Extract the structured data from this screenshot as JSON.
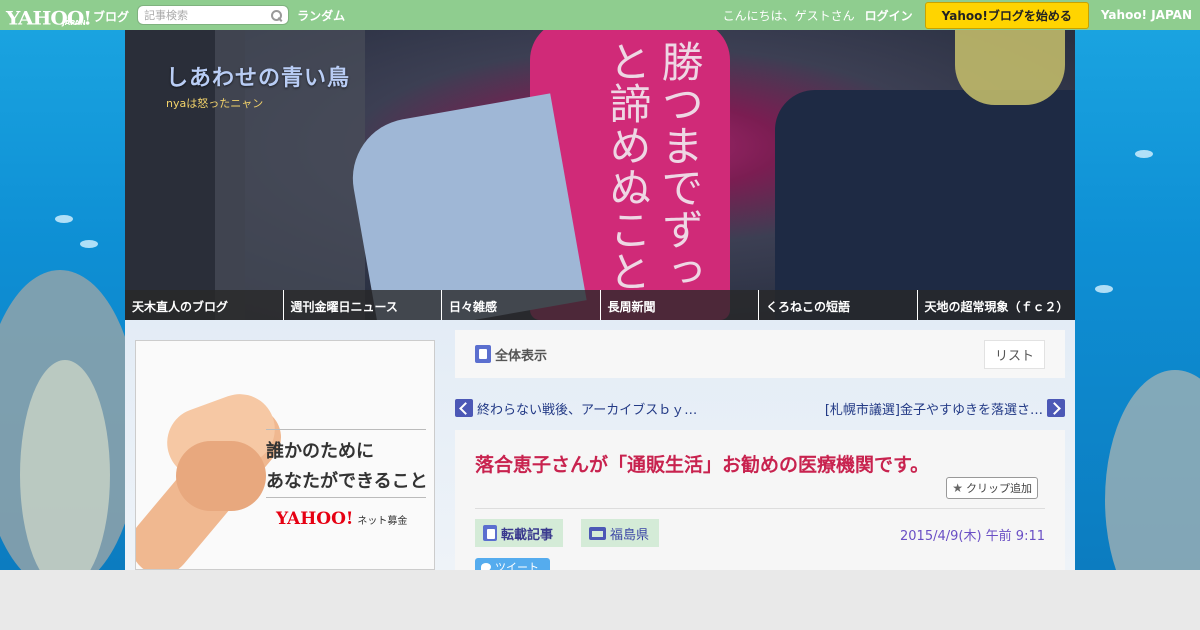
{
  "topbar": {
    "logo_text": "YAHOO!",
    "logo_sub": "JAPAN",
    "logo_blog": "ブログ",
    "search_placeholder": "記事検索",
    "random_label": "ランダム",
    "greeting": "こんにちは、ゲストさん",
    "login_label": "ログイン",
    "start_blog_label": "Yahoo!ブログを始める",
    "yahoo_japan_label": "Yahoo! JAPAN"
  },
  "header": {
    "blog_title": "しあわせの青い鳥",
    "blog_subtitle": "nyaは怒ったニャン",
    "shirt_text": "勝つまでずっと諦めぬこと"
  },
  "nav": {
    "items": [
      {
        "label": "天木直人のブログ"
      },
      {
        "label": "週刊金曜日ニュース"
      },
      {
        "label": "日々雑感"
      },
      {
        "label": "長周新聞"
      },
      {
        "label": "くろねこの短語"
      },
      {
        "label": "天地の超常現象（ｆｃ２）"
      }
    ]
  },
  "ad": {
    "line1": "誰かのために",
    "line2": "あなたができること",
    "logo": "YAHOO!",
    "logo_sub": "JAPAN",
    "service": "ネット募金"
  },
  "panel": {
    "title": "全体表示",
    "list_label": "リスト"
  },
  "pager": {
    "prev": "終わらない戦後、アーカイブスｂｙ…",
    "next": "[札幌市議選]金子やすゆきを落選さ…"
  },
  "article": {
    "title": "落合恵子さんが「通販生活」お勧めの医療機関です。",
    "clip_label": "クリップ追加",
    "tag_repost": "転載記事",
    "tag_category": "福島県",
    "date": "2015/4/9(木) 午前 9:11",
    "tweet_label": "ツイート"
  },
  "colors": {
    "topbar": "#8fcd8f",
    "accent_title": "#c8234f",
    "link": "#233a86",
    "start_button": "#ffd400"
  }
}
